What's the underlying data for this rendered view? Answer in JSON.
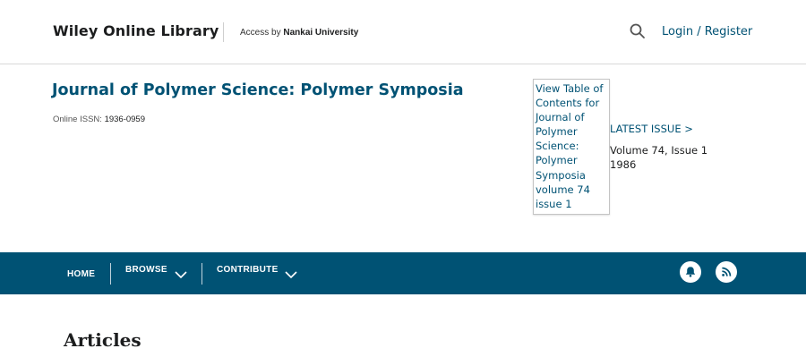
{
  "header": {
    "logo": "Wiley Online Library",
    "access_prefix": "Access by",
    "access_institution": "Nankai University",
    "login": "Login",
    "login_sep": " / ",
    "register": "Register",
    "search_icon": "search-icon"
  },
  "journal": {
    "title": "Journal of Polymer Science: Polymer Symposia",
    "issn_label": "Online ISSN:",
    "issn_value": "1936-0959",
    "cover_link_text": "View Table of Contents for Journal of Polymer Science: Polymer Symposia volume 74 issue 1",
    "latest_issue_label": "LATEST ISSUE >",
    "latest_issue_volume": "Volume 74, Issue 1",
    "latest_issue_year": "1986"
  },
  "nav": {
    "home": "HOME",
    "browse": "BROWSE",
    "contribute": "CONTRIBUTE",
    "icons": [
      "chevron-down-icon",
      "bell-icon",
      "rss-icon"
    ]
  },
  "main": {
    "heading": "Articles"
  },
  "colors": {
    "brand": "#005274",
    "text": "#1c1d1e",
    "nav_bg": "#005274"
  }
}
